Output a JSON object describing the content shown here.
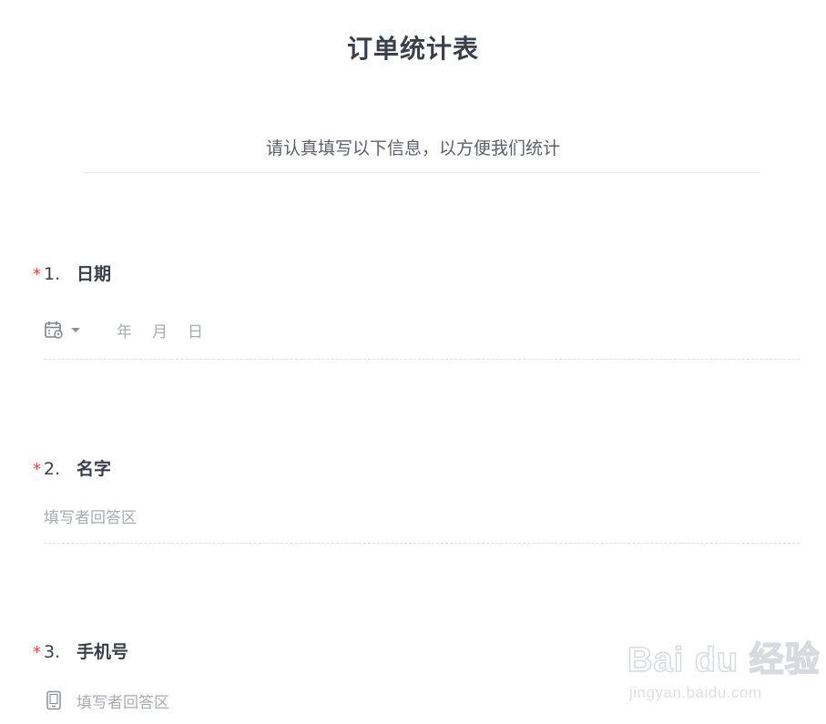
{
  "form": {
    "title": "订单统计表",
    "description": "请认真填写以下信息，以方便我们统计"
  },
  "questions": [
    {
      "required_mark": "*",
      "number": "1.",
      "title": "日期",
      "type": "date",
      "units": [
        "年",
        "月",
        "日"
      ],
      "icon": "calendar-icon"
    },
    {
      "required_mark": "*",
      "number": "2.",
      "title": "名字",
      "type": "text",
      "placeholder": "填写者回答区"
    },
    {
      "required_mark": "*",
      "number": "3.",
      "title": "手机号",
      "type": "phone",
      "placeholder": "填写者回答区",
      "icon": "phone-icon"
    }
  ],
  "watermark": {
    "line1": "Bai du 经验",
    "line2": "jingyan.baidu.com"
  },
  "colors": {
    "required": "#e0473e",
    "text": "#3a3f4b",
    "placeholder": "#a7abb3",
    "divider": "#dcdfe5"
  }
}
